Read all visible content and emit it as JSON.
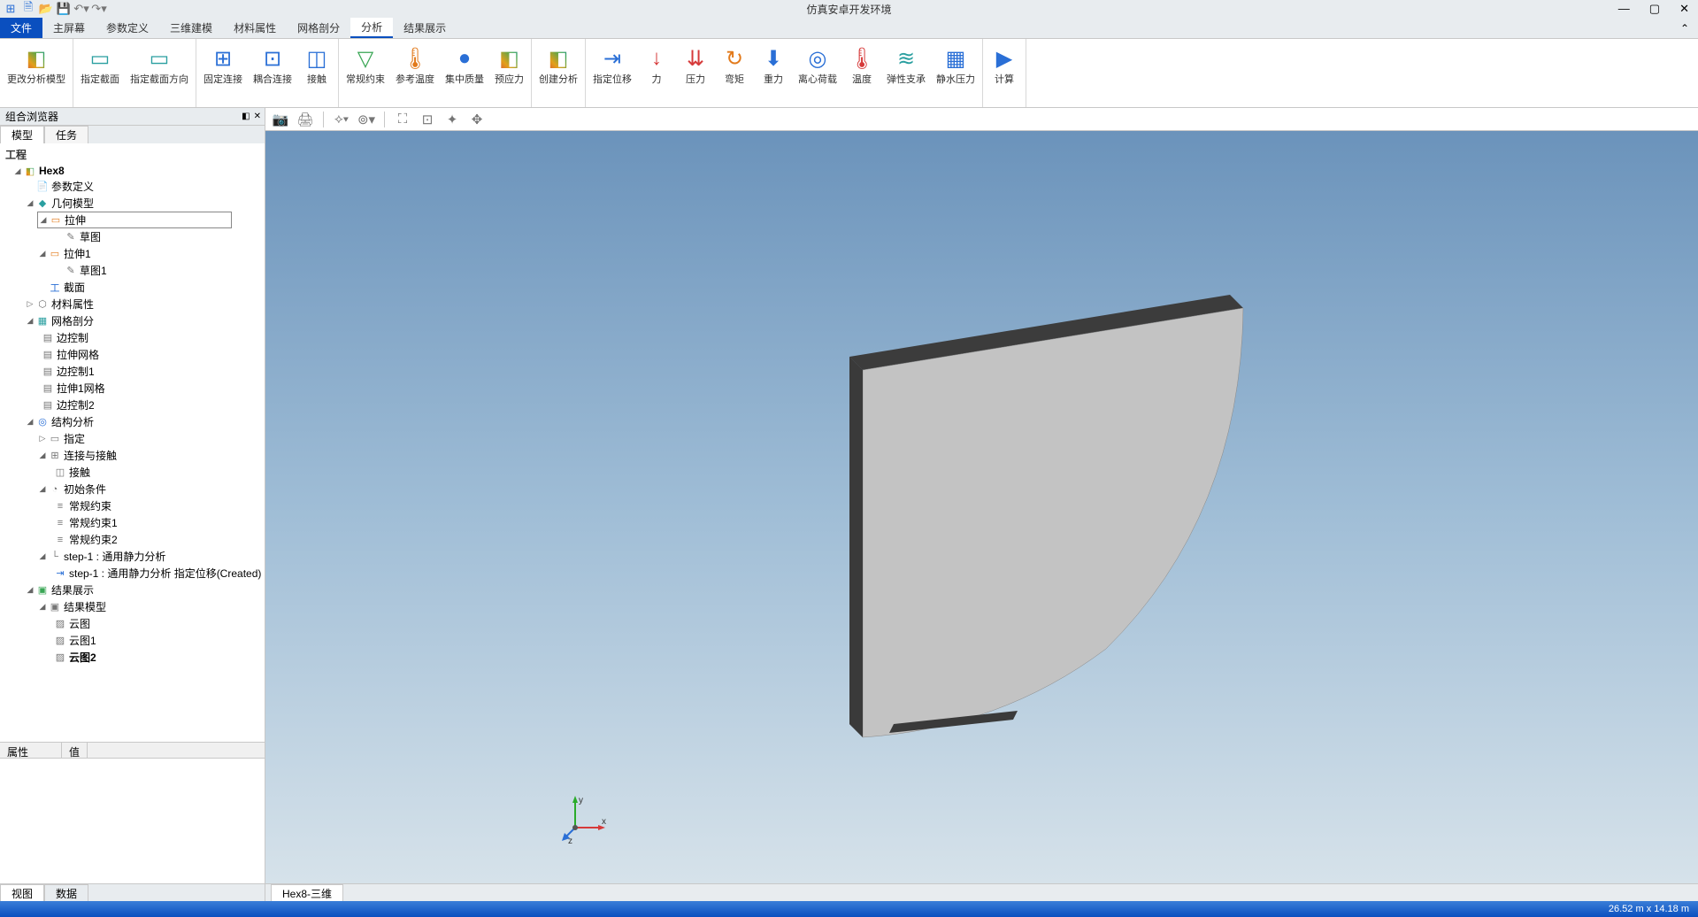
{
  "app": {
    "title": "仿真安卓开发环境"
  },
  "menubar": {
    "file": "文件",
    "items": [
      "主屏幕",
      "参数定义",
      "三维建模",
      "材料属性",
      "网格剖分",
      "分析",
      "结果展示"
    ],
    "active_index": 5
  },
  "ribbon": {
    "groups": [
      {
        "buttons": [
          {
            "label": "更改分析模型",
            "icon": "◧",
            "cls": "ic-rainbow"
          }
        ]
      },
      {
        "buttons": [
          {
            "label": "指定截面",
            "icon": "▭",
            "cls": "ic-teal"
          },
          {
            "label": "指定截面方向",
            "icon": "▭",
            "cls": "ic-teal"
          }
        ]
      },
      {
        "buttons": [
          {
            "label": "固定连接",
            "icon": "⊞",
            "cls": "ic-blue"
          },
          {
            "label": "耦合连接",
            "icon": "⊡",
            "cls": "ic-blue"
          },
          {
            "label": "接触",
            "icon": "◫",
            "cls": "ic-blue"
          }
        ]
      },
      {
        "buttons": [
          {
            "label": "常规约束",
            "icon": "▽",
            "cls": "ic-green"
          },
          {
            "label": "参考温度",
            "icon": "🌡",
            "cls": "ic-orange"
          },
          {
            "label": "集中质量",
            "icon": "●",
            "cls": "ic-blue"
          },
          {
            "label": "预应力",
            "icon": "◧",
            "cls": "ic-rainbow"
          }
        ]
      },
      {
        "buttons": [
          {
            "label": "创建分析",
            "icon": "◧",
            "cls": "ic-rainbow"
          }
        ]
      },
      {
        "buttons": [
          {
            "label": "指定位移",
            "icon": "⇥",
            "cls": "ic-blue"
          },
          {
            "label": "力",
            "icon": "↓",
            "cls": "ic-red"
          },
          {
            "label": "压力",
            "icon": "⇊",
            "cls": "ic-red"
          },
          {
            "label": "弯矩",
            "icon": "↻",
            "cls": "ic-orange"
          },
          {
            "label": "重力",
            "icon": "⬇",
            "cls": "ic-blue"
          },
          {
            "label": "离心荷载",
            "icon": "◎",
            "cls": "ic-blue"
          },
          {
            "label": "温度",
            "icon": "🌡",
            "cls": "ic-red"
          },
          {
            "label": "弹性支承",
            "icon": "≋",
            "cls": "ic-teal"
          },
          {
            "label": "静水压力",
            "icon": "▦",
            "cls": "ic-blue"
          }
        ]
      },
      {
        "buttons": [
          {
            "label": "计算",
            "icon": "▶",
            "cls": "ic-blue"
          }
        ]
      }
    ]
  },
  "browser": {
    "title": "组合浏览器",
    "tabs": {
      "model": "模型",
      "task": "任务",
      "active": 0
    },
    "root": "工程",
    "project": "Hex8",
    "nodes": {
      "param_def": "参数定义",
      "geometry": "几何模型",
      "extrude": "拉伸",
      "sketch": "草图",
      "extrude1": "拉伸1",
      "sketch1": "草图1",
      "section": "截面",
      "material": "材料属性",
      "mesh": "网格剖分",
      "edge_ctrl": "边控制",
      "extrude_mesh": "拉伸网格",
      "edge_ctrl1": "边控制1",
      "extrude1_mesh": "拉伸1网格",
      "edge_ctrl2": "边控制2",
      "structural": "结构分析",
      "assign": "指定",
      "connections": "连接与接触",
      "contact": "接触",
      "initial_cond": "初始条件",
      "constraint": "常规约束",
      "constraint1": "常规约束1",
      "constraint2": "常规约束2",
      "step1": "step-1 : 通用静力分析",
      "step1_disp": "step-1 : 通用静力分析 指定位移(Created)",
      "results": "结果展示",
      "result_model": "结果模型",
      "contour": "云图",
      "contour1": "云图1",
      "contour2": "云图2"
    }
  },
  "properties": {
    "col_attr": "属性",
    "col_value": "值"
  },
  "left_bottom_tabs": {
    "view": "视图",
    "data": "数据",
    "active": 0
  },
  "viewport": {
    "tab": "Hex8-三维",
    "triad": {
      "x": "x",
      "y": "y",
      "z": "z"
    }
  },
  "statusbar": {
    "dimensions": "26.52 m x 14.18 m"
  }
}
